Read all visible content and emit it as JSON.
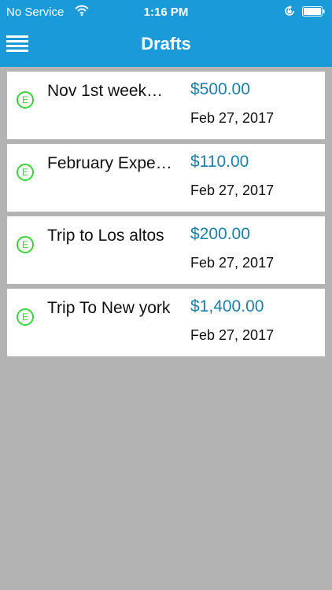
{
  "status_bar": {
    "carrier": "No Service",
    "time": "1:16 PM",
    "icons": [
      "wifi-icon",
      "orientation-lock-icon",
      "battery-icon"
    ]
  },
  "nav": {
    "title": "Drafts",
    "menu_icon": "hamburger-menu-icon"
  },
  "colors": {
    "header": "#1a9ad9",
    "background": "#b3b3b3",
    "amount": "#1c7fa8",
    "badge": "#39d43c"
  },
  "drafts": [
    {
      "badge": "E",
      "title": "Nov 1st week…",
      "amount": "$500.00",
      "date": "Feb 27, 2017"
    },
    {
      "badge": "E",
      "title": "February Expe…",
      "amount": "$110.00",
      "date": "Feb 27, 2017"
    },
    {
      "badge": "E",
      "title": "Trip to Los altos",
      "amount": "$200.00",
      "date": "Feb 27, 2017"
    },
    {
      "badge": "E",
      "title": "Trip To New york",
      "amount": "$1,400.00",
      "date": "Feb 27, 2017"
    }
  ]
}
